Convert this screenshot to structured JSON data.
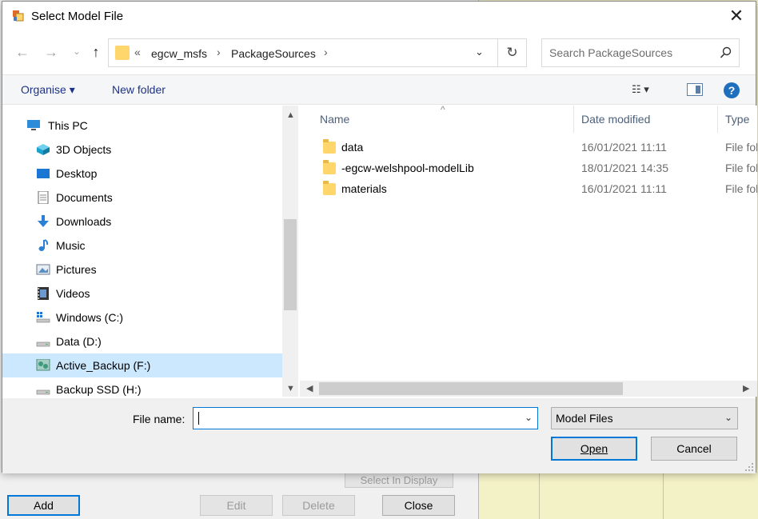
{
  "dialog": {
    "title": "Select Model File",
    "close_glyph": "✕"
  },
  "address": {
    "overflow": "«",
    "crumbs": [
      "egcw_msfs",
      "PackageSources"
    ],
    "search_placeholder": "Search PackageSources"
  },
  "toolbar": {
    "organise": "Organise ▾",
    "new_folder": "New folder",
    "help": "?"
  },
  "nav_pane": {
    "items": [
      {
        "label": "This PC",
        "icon": "this-pc-icon",
        "selected": false
      },
      {
        "label": "3D Objects",
        "icon": "3d-objects-icon",
        "selected": false
      },
      {
        "label": "Desktop",
        "icon": "desktop-icon",
        "selected": false
      },
      {
        "label": "Documents",
        "icon": "documents-icon",
        "selected": false
      },
      {
        "label": "Downloads",
        "icon": "downloads-icon",
        "selected": false
      },
      {
        "label": "Music",
        "icon": "music-icon",
        "selected": false
      },
      {
        "label": "Pictures",
        "icon": "pictures-icon",
        "selected": false
      },
      {
        "label": "Videos",
        "icon": "videos-icon",
        "selected": false
      },
      {
        "label": "Windows (C:)",
        "icon": "drive-c-icon",
        "selected": false
      },
      {
        "label": "Data (D:)",
        "icon": "drive-d-icon",
        "selected": false
      },
      {
        "label": "Active_Backup (F:)",
        "icon": "network-drive-icon",
        "selected": true
      },
      {
        "label": "Backup SSD (H:)",
        "icon": "drive-h-icon",
        "selected": false
      }
    ]
  },
  "file_list": {
    "columns": {
      "name": "Name",
      "date": "Date modified",
      "type": "Type"
    },
    "rows": [
      {
        "name": "data",
        "date": "16/01/2021 11:11",
        "type": "File folder"
      },
      {
        "name": "-egcw-welshpool-modelLib",
        "date": "18/01/2021 14:35",
        "type": "File folder"
      },
      {
        "name": "materials",
        "date": "16/01/2021 11:11",
        "type": "File folder"
      }
    ]
  },
  "bottom": {
    "file_name_label": "File name:",
    "file_name_value": "",
    "file_type": "Model Files",
    "open": "Open",
    "cancel": "Cancel"
  },
  "background_app": {
    "select_in_display": "Select In Display",
    "add": "Add",
    "edit": "Edit",
    "delete": "Delete",
    "close": "Close"
  },
  "colors": {
    "accent": "#0078d7",
    "selection": "#cce8ff",
    "folder": "#ffd66b",
    "bg_yellow": "#f3f1c6"
  }
}
